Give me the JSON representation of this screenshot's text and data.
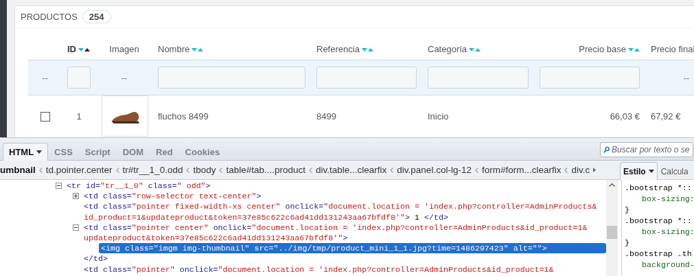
{
  "products_panel": {
    "title": "PRODUCTOS",
    "count": "254",
    "columns": [
      {
        "label": "ID",
        "sortable": true,
        "sorted_ascending": true
      },
      {
        "label": "Imagen",
        "sortable": false,
        "sorted_ascending": false
      },
      {
        "label": "Nombre",
        "sortable": true,
        "sorted_ascending": false
      },
      {
        "label": "Referencia",
        "sortable": true,
        "sorted_ascending": false
      },
      {
        "label": "Categoría",
        "sortable": true,
        "sorted_ascending": false
      },
      {
        "label": "Precio base",
        "sortable": true,
        "sorted_ascending": false
      },
      {
        "label": "Precio final",
        "sortable": false,
        "sorted_ascending": false
      }
    ],
    "filters": [
      {
        "kind": "empty",
        "text": "--"
      },
      {
        "kind": "input"
      },
      {
        "kind": "empty",
        "text": "--"
      },
      {
        "kind": "input"
      },
      {
        "kind": "input"
      },
      {
        "kind": "input"
      },
      {
        "kind": "input"
      },
      {
        "kind": "empty",
        "text": "--"
      }
    ],
    "rows": [
      {
        "checked": false,
        "id": "1",
        "name": "fluchos 8499",
        "reference": "8499",
        "category": "Inicio",
        "base_price": "66,03 €",
        "final_price": "67,92 €"
      }
    ]
  },
  "devtools": {
    "tabs": [
      {
        "label": "HTML",
        "selected": true,
        "menu": true
      },
      {
        "label": "CSS",
        "selected": false,
        "menu": false
      },
      {
        "label": "Script",
        "selected": false,
        "menu": false
      },
      {
        "label": "DOM",
        "selected": false,
        "menu": false
      },
      {
        "label": "Red",
        "selected": false,
        "menu": false
      },
      {
        "label": "Cookies",
        "selected": false,
        "menu": false
      }
    ],
    "search": {
      "placeholder": "Buscar por texto o se"
    },
    "breadcrumbs": [
      {
        "label": "umbnail",
        "selected": true
      },
      {
        "label": "td.pointer.center",
        "selected": false
      },
      {
        "label": "tr#tr__1_0.odd",
        "selected": false
      },
      {
        "label": "tbody",
        "selected": false
      },
      {
        "label": "table#tab....product",
        "selected": false
      },
      {
        "label": "div.table...clearfix",
        "selected": false
      },
      {
        "label": "div.panel.col-lg-12",
        "selected": false
      },
      {
        "label": "form#form...clearfix",
        "selected": false
      },
      {
        "label": "div.c",
        "selected": false
      }
    ],
    "side_tabs": [
      {
        "label": "Estilo",
        "selected": true,
        "menu": true
      },
      {
        "label": "Calcula",
        "selected": false,
        "menu": false
      }
    ],
    "tree": [
      {
        "kind": "expandable",
        "expanded": true,
        "selected": false,
        "lines": [
          [
            {
              "text": "<tr id=",
              "kind": "tag"
            },
            {
              "text": "\"tr__1_0\"",
              "kind": "value"
            },
            {
              "text": " class=",
              "kind": "tag"
            },
            {
              "text": "\" odd\"",
              "kind": "value"
            },
            {
              "text": ">",
              "kind": "tag"
            }
          ]
        ],
        "children": [
          {
            "kind": "expandable",
            "expanded": false,
            "selected": false,
            "lines": [
              [
                {
                  "text": "<td class=",
                  "kind": "tag"
                },
                {
                  "text": "\"row-selector text-center\"",
                  "kind": "value"
                },
                {
                  "text": ">",
                  "kind": "tag"
                }
              ]
            ]
          },
          {
            "kind": "leaf",
            "selected": false,
            "lines": [
              [
                {
                  "text": "<td class=",
                  "kind": "tag"
                },
                {
                  "text": "\"pointer fixed-width-xs center\"",
                  "kind": "value"
                },
                {
                  "text": " onclick=",
                  "kind": "tag"
                },
                {
                  "text": "\"document.location = 'index.php?controller=AdminProducts&",
                  "kind": "value"
                }
              ],
              [
                {
                  "text": "id_product=1&updateproduct&token=37e85c622c6ad41dd131243aa67bfdf8'\"",
                  "kind": "value"
                },
                {
                  "text": ">",
                  "kind": "tag"
                },
                {
                  "text": " 1 ",
                  "kind": "text"
                },
                {
                  "text": "</td>",
                  "kind": "tag"
                }
              ]
            ]
          },
          {
            "kind": "expandable",
            "expanded": true,
            "selected": false,
            "lines": [
              [
                {
                  "text": "<td class=",
                  "kind": "tag"
                },
                {
                  "text": "\"pointer center\"",
                  "kind": "value"
                },
                {
                  "text": " onclick=",
                  "kind": "tag"
                },
                {
                  "text": "\"document.location = 'index.php?controller=AdminProducts&id_product=1&",
                  "kind": "value"
                }
              ],
              [
                {
                  "text": "updateproduct&token=37e85c622c6ad41dd131243aa67bfdf8'\"",
                  "kind": "value"
                },
                {
                  "text": ">",
                  "kind": "tag"
                }
              ]
            ],
            "children": [
              {
                "kind": "leaf",
                "selected": true,
                "lines": [
                  [
                    {
                      "text": "<img class=",
                      "kind": "tag"
                    },
                    {
                      "text": "\"imgm img-thumbnail\"",
                      "kind": "value"
                    },
                    {
                      "text": " src=",
                      "kind": "tag"
                    },
                    {
                      "text": "\"../img/tmp/product_mini_1_1.jpg?time=1486297423\"",
                      "kind": "value"
                    },
                    {
                      "text": " alt=",
                      "kind": "tag"
                    },
                    {
                      "text": "\"\"",
                      "kind": "value"
                    },
                    {
                      "text": ">",
                      "kind": "tag"
                    }
                  ]
                ]
              }
            ],
            "closing": [
              {
                "text": "</td>",
                "kind": "tag"
              }
            ]
          },
          {
            "kind": "leaf",
            "selected": false,
            "lines": [
              [
                {
                  "text": "<td class=",
                  "kind": "tag"
                },
                {
                  "text": "\"pointer\"",
                  "kind": "value"
                },
                {
                  "text": " onclick=",
                  "kind": "tag"
                },
                {
                  "text": "\"document.location = 'index.php?controller=AdminProducts&id_product=1&",
                  "kind": "value"
                }
              ]
            ]
          }
        ]
      }
    ],
    "styles": [
      {
        "kind": "selector",
        "text": ".bootstrap *::"
      },
      {
        "kind": "property",
        "text": "box-sizing:"
      },
      {
        "kind": "brace",
        "text": "}"
      },
      {
        "kind": "selector",
        "text": ".bootstrap *::"
      },
      {
        "kind": "property",
        "text": "box-sizing:"
      },
      {
        "kind": "brace",
        "text": "}"
      },
      {
        "kind": "selector",
        "text": ".bootstrap .th"
      },
      {
        "kind": "property",
        "text": "background-"
      }
    ]
  }
}
